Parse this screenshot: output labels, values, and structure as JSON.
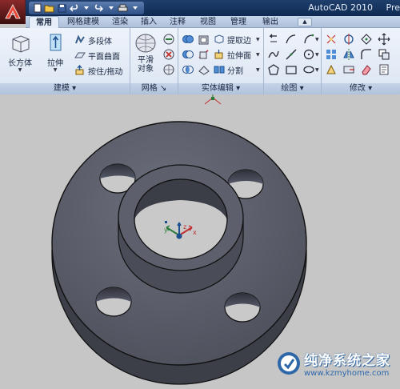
{
  "window": {
    "title": "AutoCAD 2010",
    "title_suffix": "Pre"
  },
  "tabs": [
    "常用",
    "网格建模",
    "渲染",
    "插入",
    "注释",
    "视图",
    "管理",
    "输出"
  ],
  "ribbon": {
    "modeling": {
      "title": "建模",
      "box_label": "长方体",
      "extrude_label": "拉伸",
      "polysolid_label": "多段体",
      "planar_surface_label": "平面曲面",
      "presspull_label": "按住/拖动"
    },
    "mesh": {
      "title": "网格",
      "smooth_label": "平滑\n对象",
      "smooth_line1": "平滑",
      "smooth_line2": "对象"
    },
    "solid_editing": {
      "title": "实体编辑",
      "extract_edges_label": "提取边",
      "extrude_face_label": "拉伸面",
      "separate_label": "分割"
    },
    "draw": {
      "title": "绘图"
    },
    "modify": {
      "title": "修改"
    }
  },
  "watermark": {
    "name": "纯净系统之家",
    "url": "www.kzmyhome.com"
  },
  "colors": {
    "title_bar": "#0e2a52",
    "ribbon_bg": "#dbe5f2",
    "viewport_bg": "#c6c6c6",
    "model": "#5f6270"
  }
}
